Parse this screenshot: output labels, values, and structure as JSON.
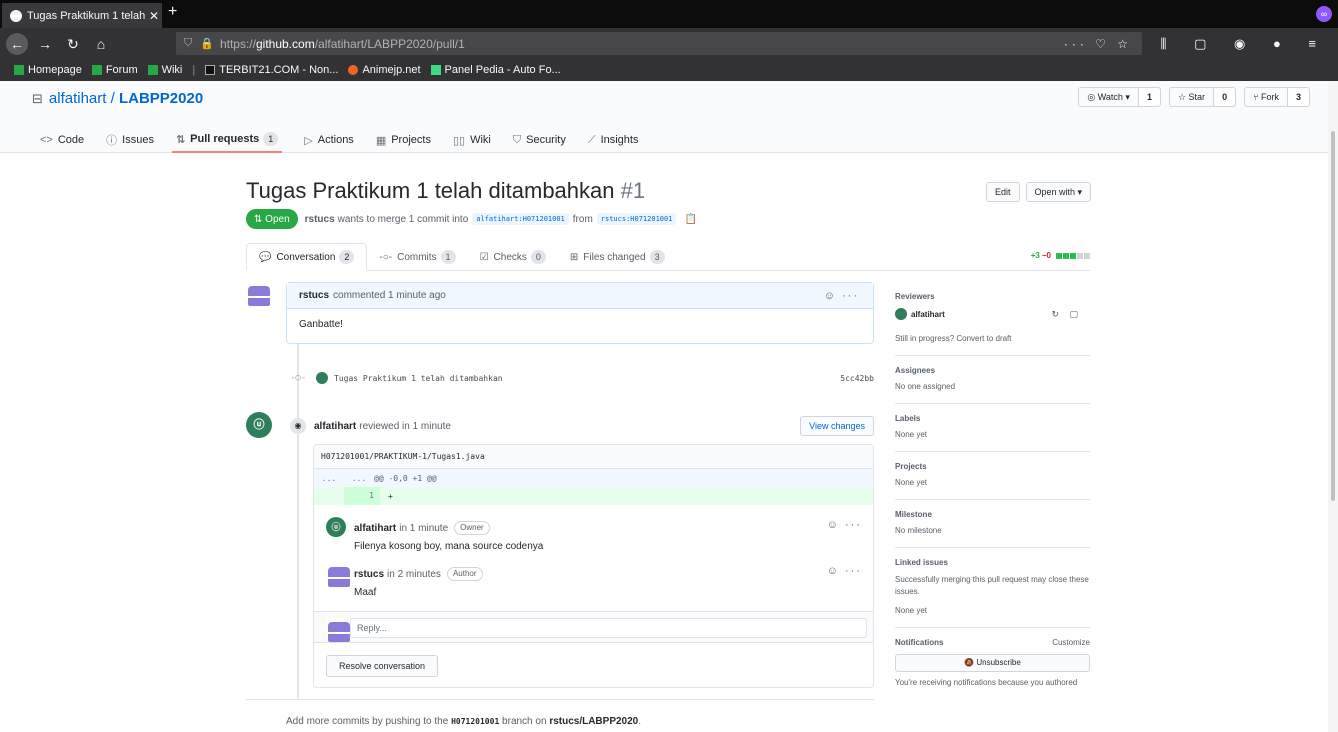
{
  "browser": {
    "tab_title": "Tugas Praktikum 1 telah ditambahkan",
    "url_prefix": "https://",
    "url_host": "github.com",
    "url_path": "/alfatihart/LABPP2020/pull/1",
    "bookmarks": [
      "Homepage",
      "Forum",
      "Wiki",
      "TERBIT21.COM - Non...",
      "Animejp.net",
      "Panel Pedia - Auto Fo..."
    ]
  },
  "repo": {
    "owner": "alfatihart",
    "name": "LABPP2020",
    "watch_label": "Watch",
    "watch_count": "1",
    "star_label": "Star",
    "star_count": "0",
    "fork_label": "Fork",
    "fork_count": "3",
    "tabs": [
      {
        "label": "Code"
      },
      {
        "label": "Issues"
      },
      {
        "label": "Pull requests",
        "count": "1"
      },
      {
        "label": "Actions"
      },
      {
        "label": "Projects"
      },
      {
        "label": "Wiki"
      },
      {
        "label": "Security"
      },
      {
        "label": "Insights"
      }
    ]
  },
  "pr": {
    "title": "Tugas Praktikum 1 telah ditambahkan",
    "number": "#1",
    "edit_label": "Edit",
    "open_with_label": "Open with",
    "state": "Open",
    "author": "rstucs",
    "merge_text": "wants to merge 1 commit into",
    "base_branch": "alfatihart:H071201001",
    "from_text": "from",
    "head_branch": "rstucs:H071201001",
    "tabs": [
      {
        "label": "Conversation",
        "count": "2"
      },
      {
        "label": "Commits",
        "count": "1"
      },
      {
        "label": "Checks",
        "count": "0"
      },
      {
        "label": "Files changed",
        "count": "3"
      }
    ],
    "additions": "+3",
    "deletions": "−0"
  },
  "comment": {
    "author": "rstucs",
    "meta": "commented 1 minute ago",
    "body": "Ganbatte!"
  },
  "commit": {
    "message": "Tugas Praktikum 1 telah ditambahkan",
    "sha": "5cc42bb"
  },
  "review": {
    "author": "alfatihart",
    "meta": "reviewed in 1 minute",
    "view_changes_label": "View changes",
    "file_path": "H071201001/PRAKTIKUM-1/Tugas1.java",
    "hunk_left": "...",
    "hunk_right": "...",
    "hunk_header": "@@ -0,0 +1 @@",
    "line_number": "1",
    "line_content": "+",
    "replies": [
      {
        "author": "alfatihart",
        "meta": "in 1 minute",
        "label": "Owner",
        "body": "Filenya kosong boy, mana source codenya"
      },
      {
        "author": "rstucs",
        "meta": "in 2 minutes",
        "label": "Author",
        "body": "Maaf"
      }
    ],
    "reply_placeholder": "Reply...",
    "resolve_label": "Resolve conversation"
  },
  "footer": {
    "prefix": "Add more commits by pushing to the",
    "branch": "H071201001",
    "middle": "branch on",
    "repo": "rstucs/LABPP2020",
    "suffix": "."
  },
  "sidebar": {
    "reviewers_heading": "Reviewers",
    "reviewer": "alfatihart",
    "draft_text": "Still in progress? Convert to draft",
    "assignees_heading": "Assignees",
    "assignees_value": "No one assigned",
    "labels_heading": "Labels",
    "labels_value": "None yet",
    "projects_heading": "Projects",
    "projects_value": "None yet",
    "milestone_heading": "Milestone",
    "milestone_value": "No milestone",
    "linked_heading": "Linked issues",
    "linked_text": "Successfully merging this pull request may close these issues.",
    "linked_value": "None yet",
    "notifications_heading": "Notifications",
    "customize_label": "Customize",
    "unsubscribe_label": "Unsubscribe",
    "notif_text": "You're receiving notifications because you authored"
  }
}
